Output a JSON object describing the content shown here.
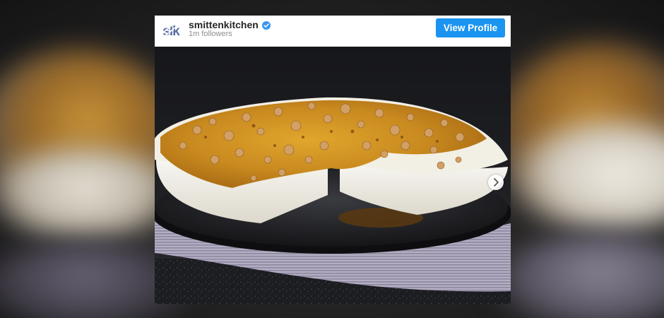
{
  "post": {
    "username": "smittenkitchen",
    "followers": "1m followers",
    "verified": true,
    "view_profile_label": "View Profile",
    "brand_color": "#1a94f0",
    "avatar_icon": "sk-logo-icon",
    "carousel_icon": "chevron-right-icon"
  }
}
